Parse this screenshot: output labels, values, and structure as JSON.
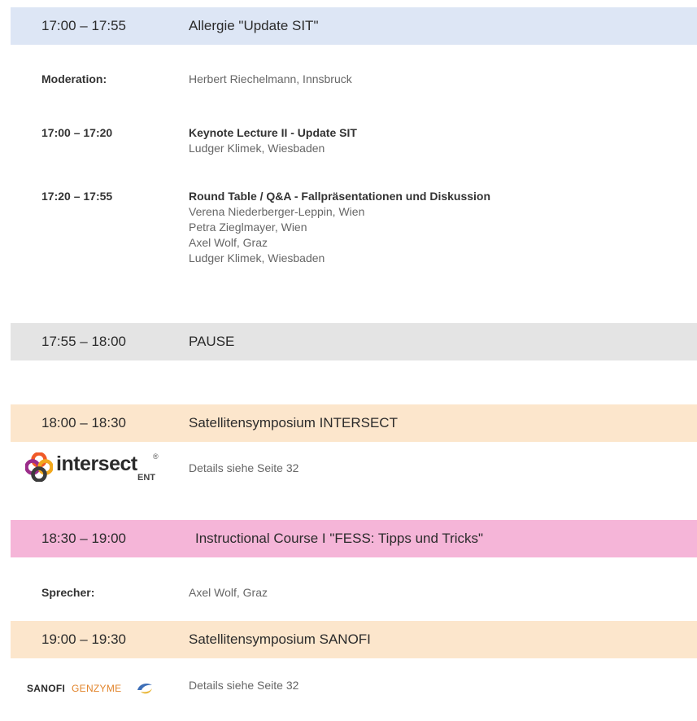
{
  "sessions": [
    {
      "time": "17:00 – 17:55",
      "title": "Allergie \"Update SIT\""
    },
    {
      "time": "17:55 – 18:00",
      "title": "PAUSE"
    },
    {
      "time": "18:00 – 18:30",
      "title": "Satellitensymposium INTERSECT"
    },
    {
      "time": "18:30 – 19:00",
      "title": "Instructional Course I \"FESS: Tipps und Tricks\""
    },
    {
      "time": "19:00 – 19:30",
      "title": "Satellitensymposium SANOFI"
    }
  ],
  "allergie": {
    "moderation_label": "Moderation:",
    "moderation_value": "Herbert Riechelmann, Innsbruck",
    "items": [
      {
        "time": "17:00 – 17:20",
        "title": "Keynote Lecture II - Update SIT",
        "speakers": [
          "Ludger Klimek, Wiesbaden"
        ]
      },
      {
        "time": "17:20 – 17:55",
        "title": "Round Table / Q&A - Fallpräsentationen und Diskussion",
        "speakers": [
          "Verena Niederberger-Leppin, Wien",
          "Petra Zieglmayer, Wien",
          "Axel Wolf, Graz",
          "Ludger Klimek, Wiesbaden"
        ]
      }
    ]
  },
  "intersect": {
    "logo_word": "intersect",
    "logo_mark": "®",
    "logo_sub": "ENT",
    "details": "Details siehe Seite 32"
  },
  "course": {
    "speaker_label": "Sprecher:",
    "speaker_value": "Axel Wolf, Graz"
  },
  "sanofi": {
    "logo_a": "SANOFI",
    "logo_b": "GENZYME",
    "details": "Details siehe Seite 32"
  },
  "colors": {
    "blue_band": "#dde6f5",
    "grey_band": "#e4e4e4",
    "peach_band": "#fce6cc",
    "pink_band": "#f5b5d8"
  }
}
